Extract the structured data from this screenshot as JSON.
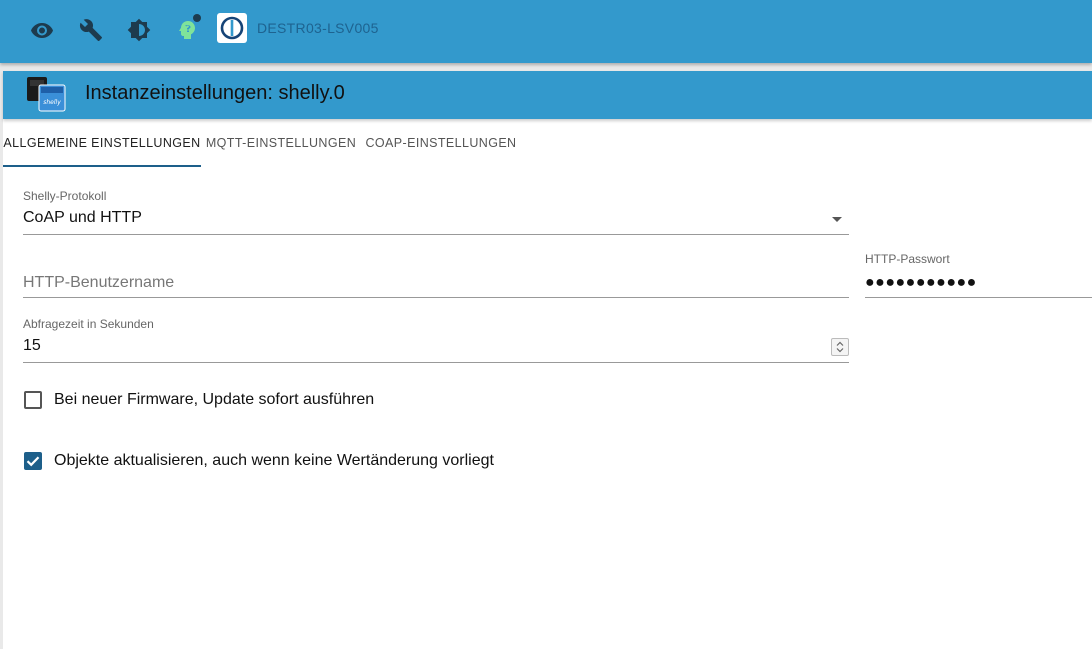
{
  "topbar": {
    "icons": [
      "eye-icon",
      "wrench-icon",
      "brightness-icon",
      "expert-mode-icon"
    ],
    "host_name": "DESTR03-LSV005",
    "colors": {
      "bar": "#3399cc",
      "expert_icon": "#7fe39a"
    }
  },
  "card": {
    "title": "Instanzeinstellungen: shelly.0",
    "adapter_logo_text": "shelly"
  },
  "tabs": [
    {
      "label": "ALLGEMEINE EINSTELLUNGEN",
      "active": true
    },
    {
      "label": "MQTT-EINSTELLUNGEN",
      "active": false
    },
    {
      "label": "COAP-EINSTELLUNGEN",
      "active": false
    }
  ],
  "form": {
    "protocol": {
      "label": "Shelly-Protokoll",
      "value": "CoAP und HTTP"
    },
    "username": {
      "placeholder": "HTTP-Benutzername",
      "value": ""
    },
    "password": {
      "label": "HTTP-Passwort",
      "value": "●●●●●●●●●●●"
    },
    "poll": {
      "label": "Abfragezeit in Sekunden",
      "value": "15"
    },
    "firmware_update": {
      "label": "Bei neuer Firmware, Update sofort ausführen",
      "checked": false
    },
    "update_objects": {
      "label": "Objekte aktualisieren, auch wenn keine Wertänderung vorliegt",
      "checked": true
    }
  }
}
